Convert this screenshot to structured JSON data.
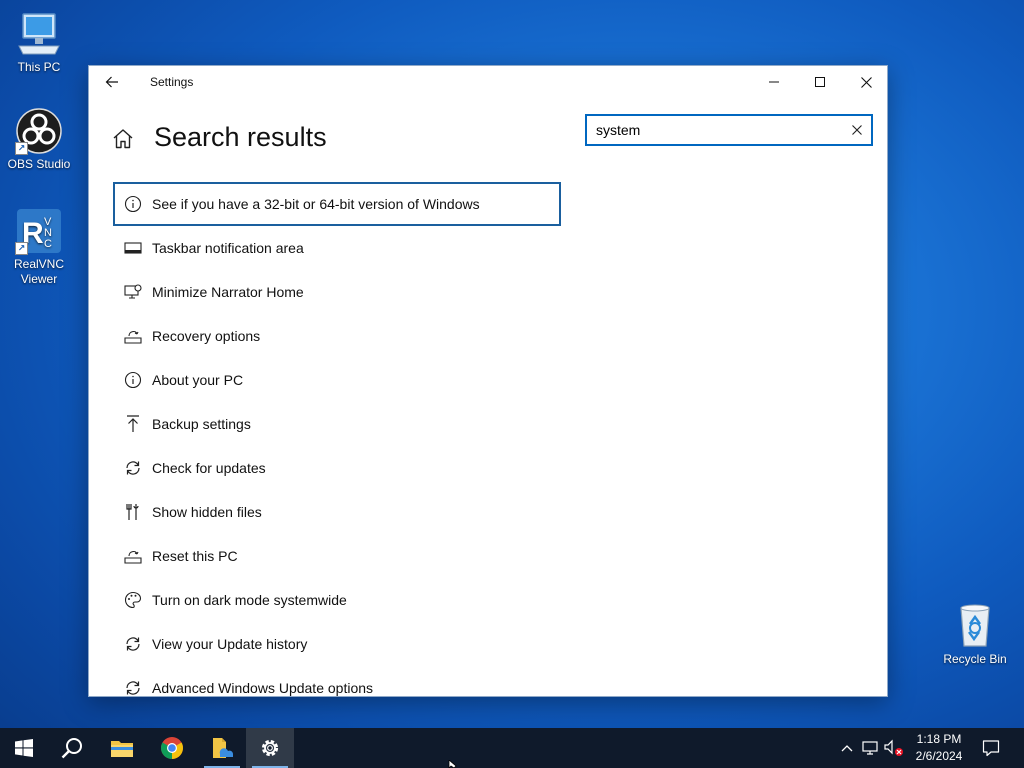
{
  "desktop": {
    "icons": [
      {
        "label": "This PC",
        "icon": "computer-icon"
      },
      {
        "label": "OBS Studio",
        "icon": "obs-icon"
      },
      {
        "label": "RealVNC Viewer",
        "icon": "vnc-icon"
      },
      {
        "label": "Recycle Bin",
        "icon": "recycle-bin-icon"
      }
    ]
  },
  "window": {
    "title": "Settings",
    "page_title": "Search results",
    "search": {
      "value": "system",
      "placeholder": ""
    },
    "results": [
      {
        "label": "See if you have a 32-bit or 64-bit version of Windows",
        "icon": "info-icon"
      },
      {
        "label": "Taskbar notification area",
        "icon": "taskbar-icon"
      },
      {
        "label": "Minimize Narrator Home",
        "icon": "narrator-icon"
      },
      {
        "label": "Recovery options",
        "icon": "recovery-icon"
      },
      {
        "label": "About your PC",
        "icon": "info-icon"
      },
      {
        "label": "Backup settings",
        "icon": "backup-arrow-icon"
      },
      {
        "label": "Check for updates",
        "icon": "refresh-icon"
      },
      {
        "label": "Show hidden files",
        "icon": "tools-icon"
      },
      {
        "label": "Reset this PC",
        "icon": "recovery-icon"
      },
      {
        "label": "Turn on dark mode systemwide",
        "icon": "palette-icon"
      },
      {
        "label": "View your Update history",
        "icon": "refresh-icon"
      },
      {
        "label": "Advanced Windows Update options",
        "icon": "refresh-icon"
      }
    ]
  },
  "taskbar": {
    "apps": [
      "start-icon",
      "search-icon",
      "file-explorer-icon",
      "chrome-icon",
      "file-manager-icon",
      "settings-gear-icon"
    ],
    "clock": {
      "time": "1:18 PM",
      "date": "2/6/2024"
    }
  },
  "colors": {
    "accent": "#0067c0",
    "focus_border": "#1a5f9e",
    "taskbar": "#0f1a2b"
  }
}
